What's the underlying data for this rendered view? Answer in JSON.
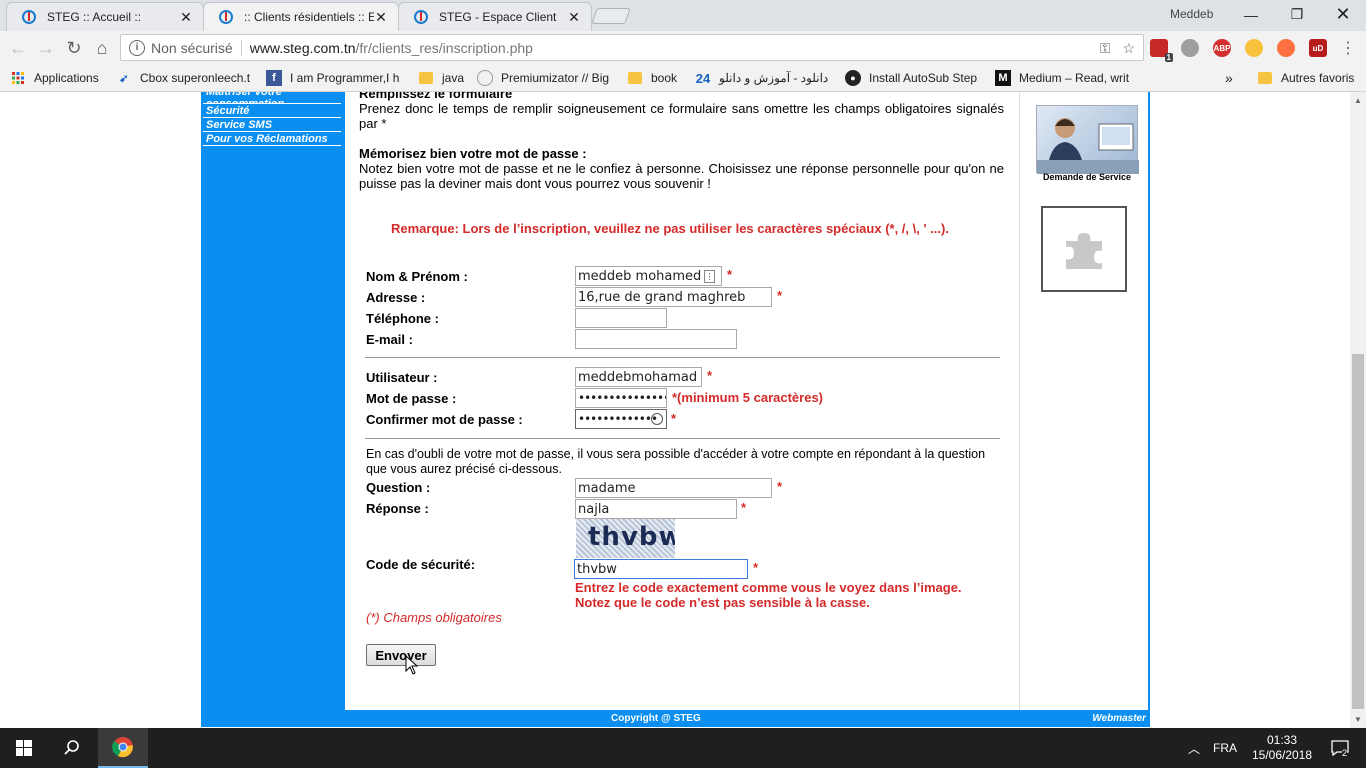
{
  "browser": {
    "tabs": [
      {
        "title": "STEG :: Accueil ::",
        "active": false
      },
      {
        "title": ":: Clients résidentiels :: Esp",
        "active": true
      },
      {
        "title": "STEG - Espace Client",
        "active": false
      }
    ],
    "profile_name": "Meddeb",
    "security_label": "Non sécurisé",
    "url_host": "www.steg.com.tn",
    "url_path": "/fr/clients_res/inscription.php",
    "extension_badge": "1",
    "abp_label": "ABP",
    "ublock_label": "uD",
    "bookmarks": [
      "Applications",
      "Cbox superonleech.t",
      "I am Programmer,I h",
      "java",
      "Premiumizator // Big",
      "book",
      "دانلود - آموزش و دانلو",
      "Install AutoSub Step",
      "Medium – Read, writ",
      "Autres favoris"
    ],
    "bookmarks_overflow": "»"
  },
  "sidebar": {
    "links": [
      "Maîtriser votre consommation",
      "Sécurité",
      "Service SMS",
      "Pour vos Réclamations"
    ]
  },
  "intro": {
    "heading": "Remplissez le formulaire",
    "text": "Prenez donc le temps de remplir soigneusement ce formulaire sans omettre les champs obligatoires signalés par *",
    "pw_heading": "Mémorisez bien votre mot de passe :",
    "pw_text": "Notez bien votre mot de passe et ne le confiez à personne. Choisissez une réponse personnelle pour qu'on ne puisse pas la deviner mais dont vous pourrez vous souvenir !",
    "remark": "Remarque: Lors de l’inscription, veuillez ne pas utiliser les caractères spéciaux (*, /, \\, ' ...)."
  },
  "form": {
    "name_label": "Nom & Prénom :",
    "name_value": "meddeb mohamed",
    "address_label": "Adresse :",
    "address_value": "16,rue de grand maghreb",
    "phone_label": "Téléphone :",
    "phone_value": "",
    "email_label": "E-mail :",
    "email_value": "",
    "user_label": "Utilisateur :",
    "user_value": "meddebmohamad",
    "password_label": "Mot de passe :",
    "password_value": "•••••••••••••••",
    "password_hint": "*(minimum 5 caractères)",
    "confirm_label": "Confirmer mot de passe :",
    "confirm_value": "•••••••••••••",
    "recovery_text": "En cas d'oubli de votre mot de passe, il vous sera possible d'accéder à votre compte en répondant à la question que vous aurez précisé ci-dessous.",
    "question_label": "Question :",
    "question_value": "madame",
    "answer_label": "Réponse :",
    "answer_value": "najla",
    "captcha_text": "thvbw",
    "code_label": "Code de sécurité:",
    "code_value": "thvbw",
    "code_hint_1": "Entrez le code exactement comme vous le voyez dans l’image.",
    "code_hint_2": "Notez que le code n’est pas sensible à la casse.",
    "required_note": "(*) Champs obligatoires",
    "submit_label": "Envoyer",
    "required_mark": "*"
  },
  "right": {
    "service_label": "Demande de Service"
  },
  "footer": {
    "copyright": "Copyright @ STEG",
    "webmaster": "Webmaster"
  },
  "taskbar": {
    "language": "FRA",
    "time": "01:33",
    "date": "15/06/2018",
    "notifications": "2"
  },
  "colors": {
    "accent_blue": "#0a8ef0",
    "required_red": "#d42a2a"
  }
}
